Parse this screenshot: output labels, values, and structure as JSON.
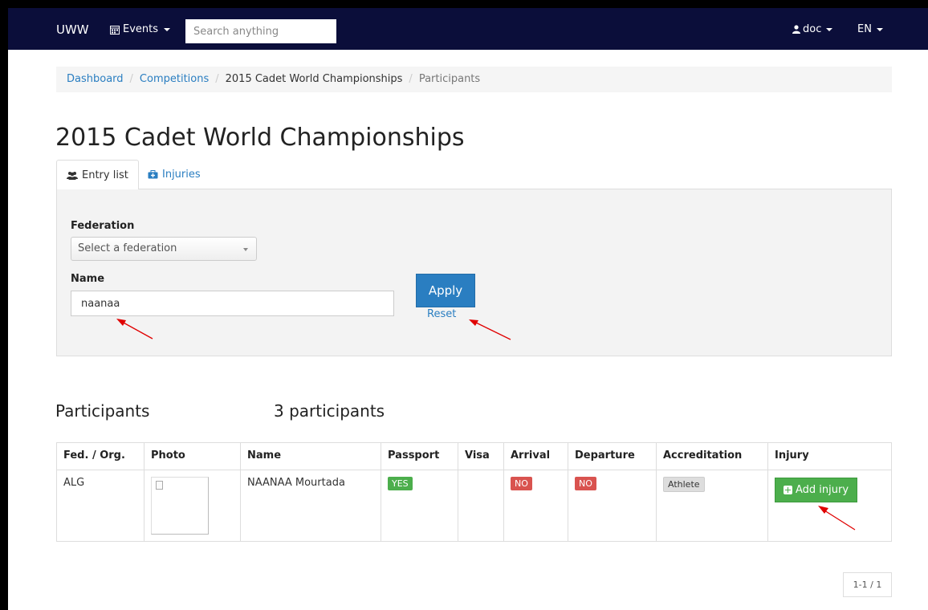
{
  "navbar": {
    "brand": "UWW",
    "events_label": "Events",
    "search_placeholder": "Search anything",
    "user_label": "doc",
    "lang_label": "EN"
  },
  "breadcrumb": {
    "items": [
      "Dashboard",
      "Competitions",
      "2015 Cadet World Championships",
      "Participants"
    ]
  },
  "page_title": "2015 Cadet World Championships",
  "tabs": [
    {
      "label": "Entry list",
      "icon": "users-icon",
      "active": true
    },
    {
      "label": "Injuries",
      "icon": "medkit-icon",
      "active": false
    }
  ],
  "filters": {
    "federation_label": "Federation",
    "federation_placeholder": "Select a federation",
    "name_label": "Name",
    "name_value": "naanaa",
    "apply_label": "Apply",
    "reset_label": "Reset"
  },
  "participants": {
    "heading": "Participants",
    "count_text": "3 participants",
    "columns": [
      "Fed. / Org.",
      "Photo",
      "Name",
      "Passport",
      "Visa",
      "Arrival",
      "Departure",
      "Accreditation",
      "Injury"
    ],
    "rows": [
      {
        "fed": "ALG",
        "name": "NAANAA Mourtada",
        "passport": "YES",
        "visa": "",
        "arrival": "NO",
        "departure": "NO",
        "accreditation": "Athlete",
        "injury_button": "Add injury"
      }
    ]
  },
  "pagination": "1-1 / 1",
  "colors": {
    "navbar_bg": "#0b0e3a",
    "link": "#2a7ec1",
    "success": "#4cae4c",
    "danger": "#d9534f",
    "annotation_arrow": "#e00000"
  }
}
